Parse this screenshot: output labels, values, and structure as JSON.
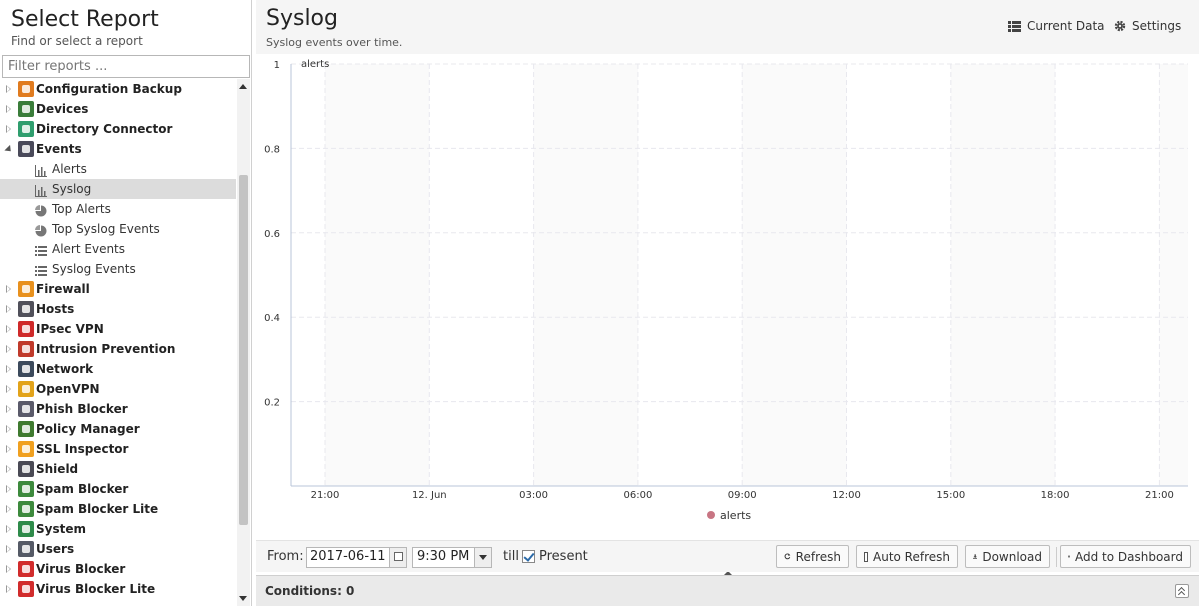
{
  "left": {
    "title": "Select Report",
    "subtitle": "Find or select a report",
    "filter_placeholder": "Filter reports ...",
    "items": [
      {
        "label": "Configuration Backup",
        "color": "#e07b1f",
        "icon": "backup-icon",
        "expanded": false
      },
      {
        "label": "Devices",
        "color": "#3a7d3a",
        "icon": "devices-icon",
        "expanded": false
      },
      {
        "label": "Directory Connector",
        "color": "#2f9e6e",
        "icon": "directory-icon",
        "expanded": false
      },
      {
        "label": "Events",
        "color": "#4a4a5a",
        "icon": "events-icon",
        "expanded": true,
        "children": [
          {
            "label": "Alerts",
            "type": "chart",
            "icon": "bar-chart-icon"
          },
          {
            "label": "Syslog",
            "type": "chart",
            "icon": "bar-chart-icon",
            "selected": true
          },
          {
            "label": "Top Alerts",
            "type": "pie",
            "icon": "pie-chart-icon"
          },
          {
            "label": "Top Syslog Events",
            "type": "pie",
            "icon": "pie-chart-icon"
          },
          {
            "label": "Alert Events",
            "type": "list",
            "icon": "list-icon"
          },
          {
            "label": "Syslog Events",
            "type": "list",
            "icon": "list-icon"
          }
        ]
      },
      {
        "label": "Firewall",
        "color": "#e8911e",
        "icon": "firewall-icon",
        "expanded": false
      },
      {
        "label": "Hosts",
        "color": "#50505a",
        "icon": "hosts-icon",
        "expanded": false
      },
      {
        "label": "IPsec VPN",
        "color": "#cf2a2a",
        "icon": "ipsec-lock-icon",
        "expanded": false
      },
      {
        "label": "Intrusion Prevention",
        "color": "#c03a2b",
        "icon": "intrusion-icon",
        "expanded": false
      },
      {
        "label": "Network",
        "color": "#3c4a5c",
        "icon": "network-icon",
        "expanded": false
      },
      {
        "label": "OpenVPN",
        "color": "#e2a31a",
        "icon": "openvpn-icon",
        "expanded": false
      },
      {
        "label": "Phish Blocker",
        "color": "#5a5a6a",
        "icon": "phish-icon",
        "expanded": false
      },
      {
        "label": "Policy Manager",
        "color": "#3f7a2f",
        "icon": "policy-icon",
        "expanded": false
      },
      {
        "label": "SSL Inspector",
        "color": "#f0a020",
        "icon": "ssl-icon",
        "expanded": false
      },
      {
        "label": "Shield",
        "color": "#4a4a55",
        "icon": "shield-icon",
        "expanded": false
      },
      {
        "label": "Spam Blocker",
        "color": "#3d8a3d",
        "icon": "spam-icon",
        "expanded": false
      },
      {
        "label": "Spam Blocker Lite",
        "color": "#3d8a3d",
        "icon": "spam-lite-icon",
        "expanded": false
      },
      {
        "label": "System",
        "color": "#2e8b4a",
        "icon": "system-icon",
        "expanded": false
      },
      {
        "label": "Users",
        "color": "#555a66",
        "icon": "users-icon",
        "expanded": false
      },
      {
        "label": "Virus Blocker",
        "color": "#d12c2c",
        "icon": "virus-icon",
        "expanded": false
      },
      {
        "label": "Virus Blocker Lite",
        "color": "#d12c2c",
        "icon": "virus-lite-icon",
        "expanded": false
      }
    ]
  },
  "report": {
    "title": "Syslog",
    "subtitle": "Syslog events over time.",
    "current_data_label": "Current Data",
    "settings_label": "Settings"
  },
  "chart_data": {
    "type": "line",
    "series": [
      {
        "name": "alerts",
        "values": [],
        "color": "#c87583"
      }
    ],
    "x_ticks": [
      "21:00",
      "12. Jun",
      "03:00",
      "06:00",
      "09:00",
      "12:00",
      "15:00",
      "18:00",
      "21:00"
    ],
    "y_ticks": [
      "0.2",
      "0.4",
      "0.6",
      "0.8",
      "1"
    ],
    "ylim": [
      0,
      1
    ],
    "grid": true,
    "legend": "bottom-center"
  },
  "bottom": {
    "from_label": "From:",
    "date_value": "2017-06-11",
    "time_value": "9:30 PM",
    "till_label": "till",
    "present_label": "Present",
    "present_checked": true,
    "refresh_label": "Refresh",
    "auto_refresh_label": "Auto Refresh",
    "download_label": "Download",
    "add_dashboard_label": "Add to Dashboard"
  },
  "conditions": {
    "label": "Conditions: 0"
  }
}
